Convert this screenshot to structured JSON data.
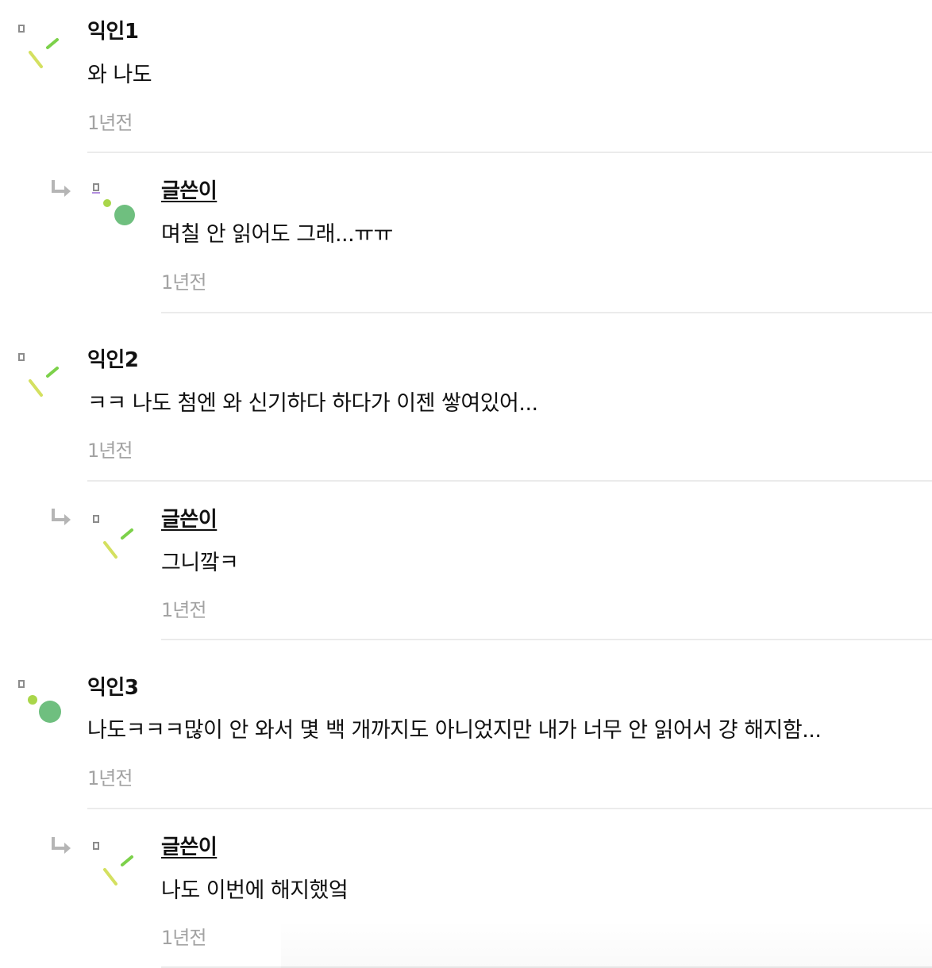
{
  "comments": [
    {
      "author": "익인1",
      "text": "와 나도",
      "time": "1년전",
      "avatar_icon": "confetti-avatar-icon",
      "reply": {
        "author": "글쓴이",
        "text": "며칠 안 읽어도 그래...ㅠㅠ",
        "time": "1년전",
        "avatar_icon": "dots-avatar-icon"
      }
    },
    {
      "author": "익인2",
      "text": "ㅋㅋ 나도 첨엔 와 신기하다 하다가 이젠 쌓여있어...",
      "time": "1년전",
      "avatar_icon": "confetti-avatar-icon",
      "reply": {
        "author": "글쓴이",
        "text": "그니깤ㅋ",
        "time": "1년전",
        "avatar_icon": "confetti-avatar-icon"
      }
    },
    {
      "author": "익인3",
      "text": "나도ㅋㅋㅋ많이 안 와서 몇 백 개까지도 아니었지만 내가 너무 안 읽어서 걍 해지함...",
      "time": "1년전",
      "avatar_icon": "dots-avatar-icon",
      "reply": {
        "author": "글쓴이",
        "text": "나도 이번에 해지했엌",
        "time": "1년전",
        "avatar_icon": "confetti-avatar-icon"
      }
    }
  ],
  "colors": {
    "text": "#111111",
    "time": "#a3a3a3",
    "divider": "#ebebeb",
    "reply_arrow": "#b5b5b5",
    "avatar_green": "#6fbf7f",
    "avatar_lime": "#a9d64a",
    "avatar_yellow": "#d4e060",
    "avatar_bright_green": "#7cd14a"
  }
}
